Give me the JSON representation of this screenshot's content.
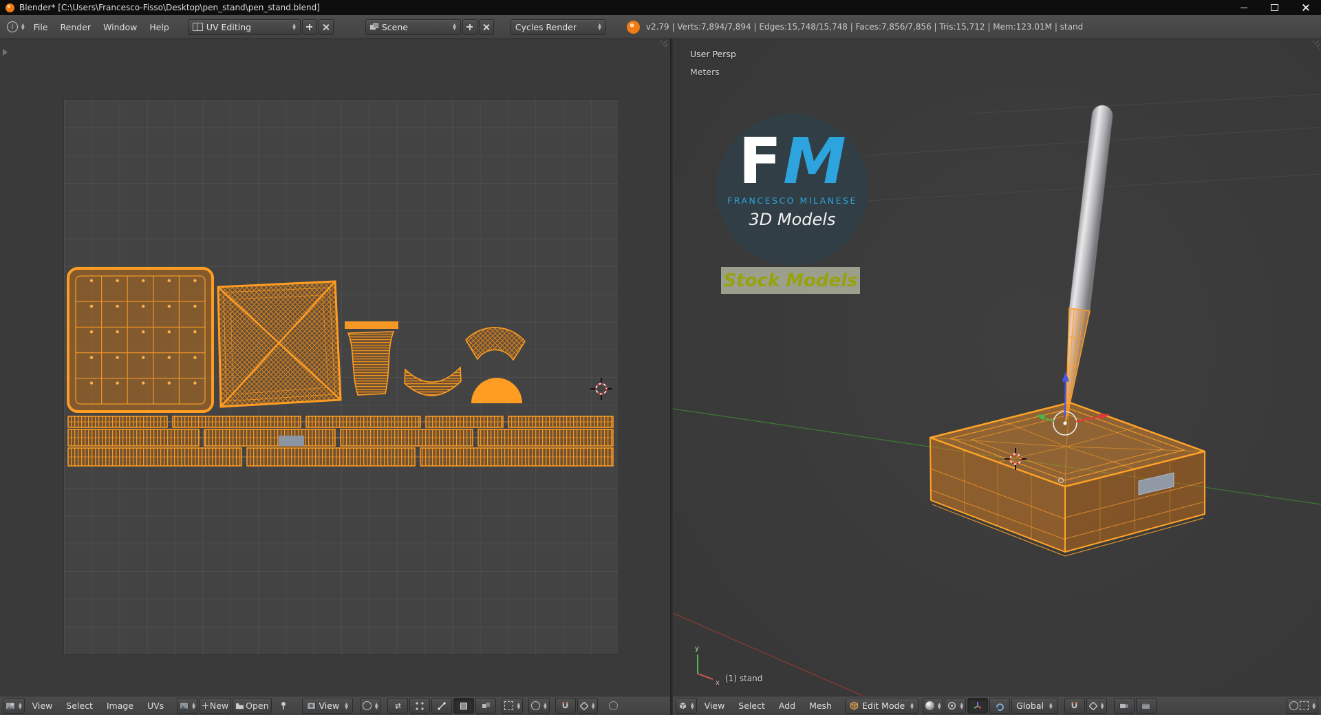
{
  "titlebar": {
    "title": "Blender* [C:\\Users\\Francesco-Fisso\\Desktop\\pen_stand\\pen_stand.blend]"
  },
  "info": {
    "menus": [
      "File",
      "Render",
      "Window",
      "Help"
    ],
    "layout": "UV Editing",
    "scene": "Scene",
    "engine": "Cycles Render",
    "stats": "v2.79 | Verts:7,894/7,894 | Edges:15,748/15,748 | Faces:7,856/7,856 | Tris:15,712 | Mem:123.01M | stand"
  },
  "uv": {
    "menus": [
      "View",
      "Select",
      "Image",
      "UVs"
    ],
    "new_label": "New",
    "open_label": "Open",
    "mode": "View"
  },
  "v3d": {
    "view_name": "User Persp",
    "units": "Meters",
    "object_info": "(1) stand",
    "menus": [
      "View",
      "Select",
      "Add",
      "Mesh"
    ],
    "mode": "Edit Mode",
    "orientation": "Global",
    "mini_axis": {
      "x": "x",
      "y": "y"
    }
  },
  "watermark": {
    "f": "F",
    "m": "M",
    "name": "FRANCESCO MILANESE",
    "models": "3D Models",
    "stock": "Stock Models"
  },
  "icons": {
    "blender-logo": "orange-circle",
    "dropdown-arrows": "▲▼",
    "plus": "+",
    "close": "✕",
    "folder": "css-folder",
    "magnet": "css-magnet"
  },
  "colors": {
    "selection_orange": "#ff9d22",
    "header_gray": "#454545",
    "viewport_gray": "#3b3b3b",
    "axis_x_red": "#8a3a35",
    "axis_y_green": "#3f7a35",
    "watermark_blue": "#2da4dd"
  }
}
